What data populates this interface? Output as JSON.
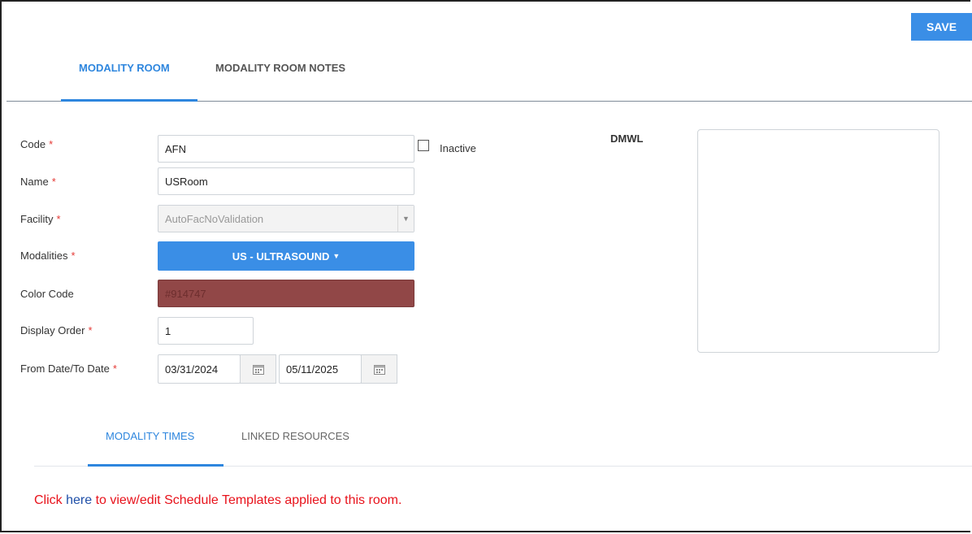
{
  "toolbar": {
    "save_label": "SAVE"
  },
  "tabs": [
    {
      "label": "MODALITY ROOM",
      "active": true
    },
    {
      "label": "MODALITY ROOM NOTES",
      "active": false
    }
  ],
  "form": {
    "code": {
      "label": "Code",
      "value": "AFN",
      "required": "*"
    },
    "inactive": {
      "label": "Inactive",
      "checked": false
    },
    "name": {
      "label": "Name",
      "value": "USRoom",
      "required": "*"
    },
    "facility": {
      "label": "Facility",
      "value": "AutoFacNoValidation",
      "required": "*"
    },
    "modalities": {
      "label": "Modalities",
      "value": "US - ULTRASOUND",
      "required": "*"
    },
    "color_code": {
      "label": "Color Code",
      "value": "#914747"
    },
    "display_order": {
      "label": "Display Order",
      "value": "1",
      "required": "*"
    },
    "dates": {
      "label": "From Date/To Date",
      "from": "03/31/2024",
      "to": "05/11/2025",
      "required": "*"
    }
  },
  "dmwl": {
    "label": "DMWL"
  },
  "sub_tabs": [
    {
      "label": "MODALITY TIMES",
      "active": true
    },
    {
      "label": "LINKED RESOURCES",
      "active": false
    }
  ],
  "notice": {
    "before": "Click ",
    "link": "here",
    "after": " to view/edit Schedule Templates applied to this room."
  },
  "colors": {
    "accent": "#2e86de",
    "button": "#3a8ee6",
    "required": "#e53935",
    "notice": "#e8121b",
    "room_color": "#914747"
  },
  "icons": {
    "calendar": "calendar-icon",
    "dropdown": "chevron-down-icon",
    "caret": "caret-down-icon"
  }
}
